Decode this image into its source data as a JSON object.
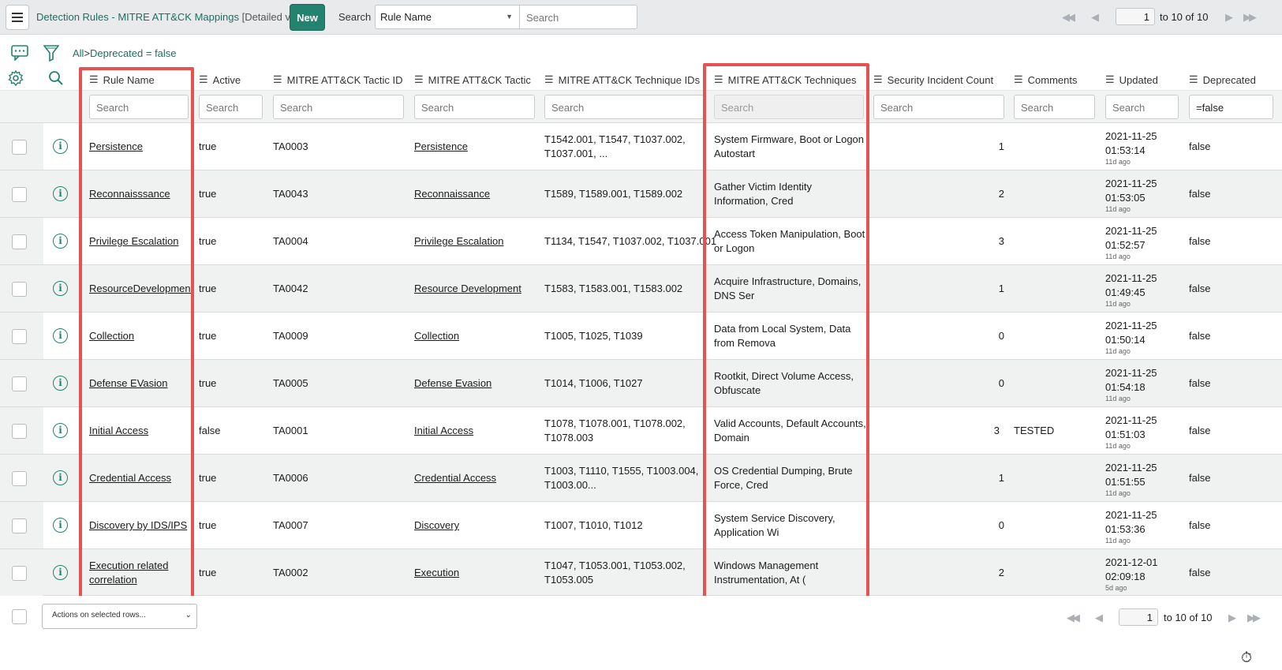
{
  "header": {
    "title": "Detection Rules - MITRE ATT&CK Mappings",
    "subtitle": "[Detailed view]",
    "new_label": "New",
    "search_label": "Search",
    "search_field": "Rule Name",
    "search_placeholder": "Search",
    "page_value": "1",
    "page_range": "to 10 of 10"
  },
  "breadcrumb": {
    "all": "All",
    "sep": ">",
    "filter": "Deprecated = false"
  },
  "columns": [
    {
      "label": "Rule Name",
      "filter": "Search"
    },
    {
      "label": "Active",
      "filter": "Search"
    },
    {
      "label": "MITRE ATT&CK Tactic ID",
      "filter": "Search"
    },
    {
      "label": "MITRE ATT&CK Tactic",
      "filter": "Search"
    },
    {
      "label": "MITRE ATT&CK Technique IDs",
      "filter": "Search"
    },
    {
      "label": "MITRE ATT&CK Techniques",
      "filter": "Search"
    },
    {
      "label": "Security Incident Count",
      "filter": "Search"
    },
    {
      "label": "Comments",
      "filter": "Search"
    },
    {
      "label": "Updated",
      "filter": "Search"
    },
    {
      "label": "Deprecated",
      "filter": "=false"
    }
  ],
  "rows": [
    {
      "rule": "Persistence",
      "active": "true",
      "tactic_id": "TA0003",
      "tactic": "Persistence",
      "tech_ids": "T1542.001, T1547, T1037.002, T1037.001, ...",
      "techniques": "System Firmware, Boot or Logon Autostart",
      "count": "1",
      "comments": "",
      "updated": "2021-11-25 01:53:14",
      "ago": "11d ago",
      "deprecated": "false"
    },
    {
      "rule": "Reconnaisssance",
      "active": "true",
      "tactic_id": "TA0043",
      "tactic": "Reconnaissance",
      "tech_ids": "T1589, T1589.001, T1589.002",
      "techniques": "Gather Victim Identity Information, Cred",
      "count": "2",
      "comments": "",
      "updated": "2021-11-25 01:53:05",
      "ago": "11d ago",
      "deprecated": "false"
    },
    {
      "rule": "Privilege Escalation",
      "active": "true",
      "tactic_id": "TA0004",
      "tactic": "Privilege Escalation",
      "tech_ids": "T1134, T1547, T1037.002, T1037.001",
      "techniques": "Access Token Manipulation, Boot or Logon",
      "count": "3",
      "comments": "",
      "updated": "2021-11-25 01:52:57",
      "ago": "11d ago",
      "deprecated": "false"
    },
    {
      "rule": "ResourceDevelopment",
      "active": "true",
      "tactic_id": "TA0042",
      "tactic": "Resource Development",
      "tech_ids": "T1583, T1583.001, T1583.002",
      "techniques": "Acquire Infrastructure, Domains, DNS Ser",
      "count": "1",
      "comments": "",
      "updated": "2021-11-25 01:49:45",
      "ago": "11d ago",
      "deprecated": "false"
    },
    {
      "rule": "Collection",
      "active": "true",
      "tactic_id": "TA0009",
      "tactic": "Collection",
      "tech_ids": "T1005, T1025, T1039",
      "techniques": "Data from Local System, Data from Remova",
      "count": "0",
      "comments": "",
      "updated": "2021-11-25 01:50:14",
      "ago": "11d ago",
      "deprecated": "false"
    },
    {
      "rule": "Defense EVasion",
      "active": "true",
      "tactic_id": "TA0005",
      "tactic": "Defense Evasion",
      "tech_ids": "T1014, T1006, T1027",
      "techniques": "Rootkit, Direct Volume Access, Obfuscate",
      "count": "0",
      "comments": "",
      "updated": "2021-11-25 01:54:18",
      "ago": "11d ago",
      "deprecated": "false"
    },
    {
      "rule": "Initial Access",
      "active": "false",
      "tactic_id": "TA0001",
      "tactic": "Initial Access",
      "tech_ids": "T1078, T1078.001, T1078.002, T1078.003",
      "techniques": "Valid Accounts, Default Accounts, Domain",
      "count": "3",
      "comments": "TESTED",
      "updated": "2021-11-25 01:51:03",
      "ago": "11d ago",
      "deprecated": "false"
    },
    {
      "rule": "Credential Access",
      "active": "true",
      "tactic_id": "TA0006",
      "tactic": "Credential Access",
      "tech_ids": "T1003, T1110, T1555, T1003.004, T1003.00...",
      "techniques": "OS Credential Dumping, Brute Force, Cred",
      "count": "1",
      "comments": "",
      "updated": "2021-11-25 01:51:55",
      "ago": "11d ago",
      "deprecated": "false"
    },
    {
      "rule": "Discovery by IDS/IPS",
      "active": "true",
      "tactic_id": "TA0007",
      "tactic": "Discovery",
      "tech_ids": "T1007, T1010, T1012",
      "techniques": "System Service Discovery, Application Wi",
      "count": "0",
      "comments": "",
      "updated": "2021-11-25 01:53:36",
      "ago": "11d ago",
      "deprecated": "false"
    },
    {
      "rule": "Execution related correlation",
      "active": "true",
      "tactic_id": "TA0002",
      "tactic": "Execution",
      "tech_ids": "T1047, T1053.001, T1053.002, T1053.005",
      "techniques": "Windows Management Instrumentation, At (",
      "count": "2",
      "comments": "",
      "updated": "2021-12-01 02:09:18",
      "ago": "5d ago",
      "deprecated": "false"
    }
  ],
  "footer": {
    "actions_label": "Actions on selected rows...",
    "page_value": "1",
    "page_range": "to 10 of 10"
  },
  "colors": {
    "accent": "#23836f",
    "highlight": "#e5524f"
  }
}
